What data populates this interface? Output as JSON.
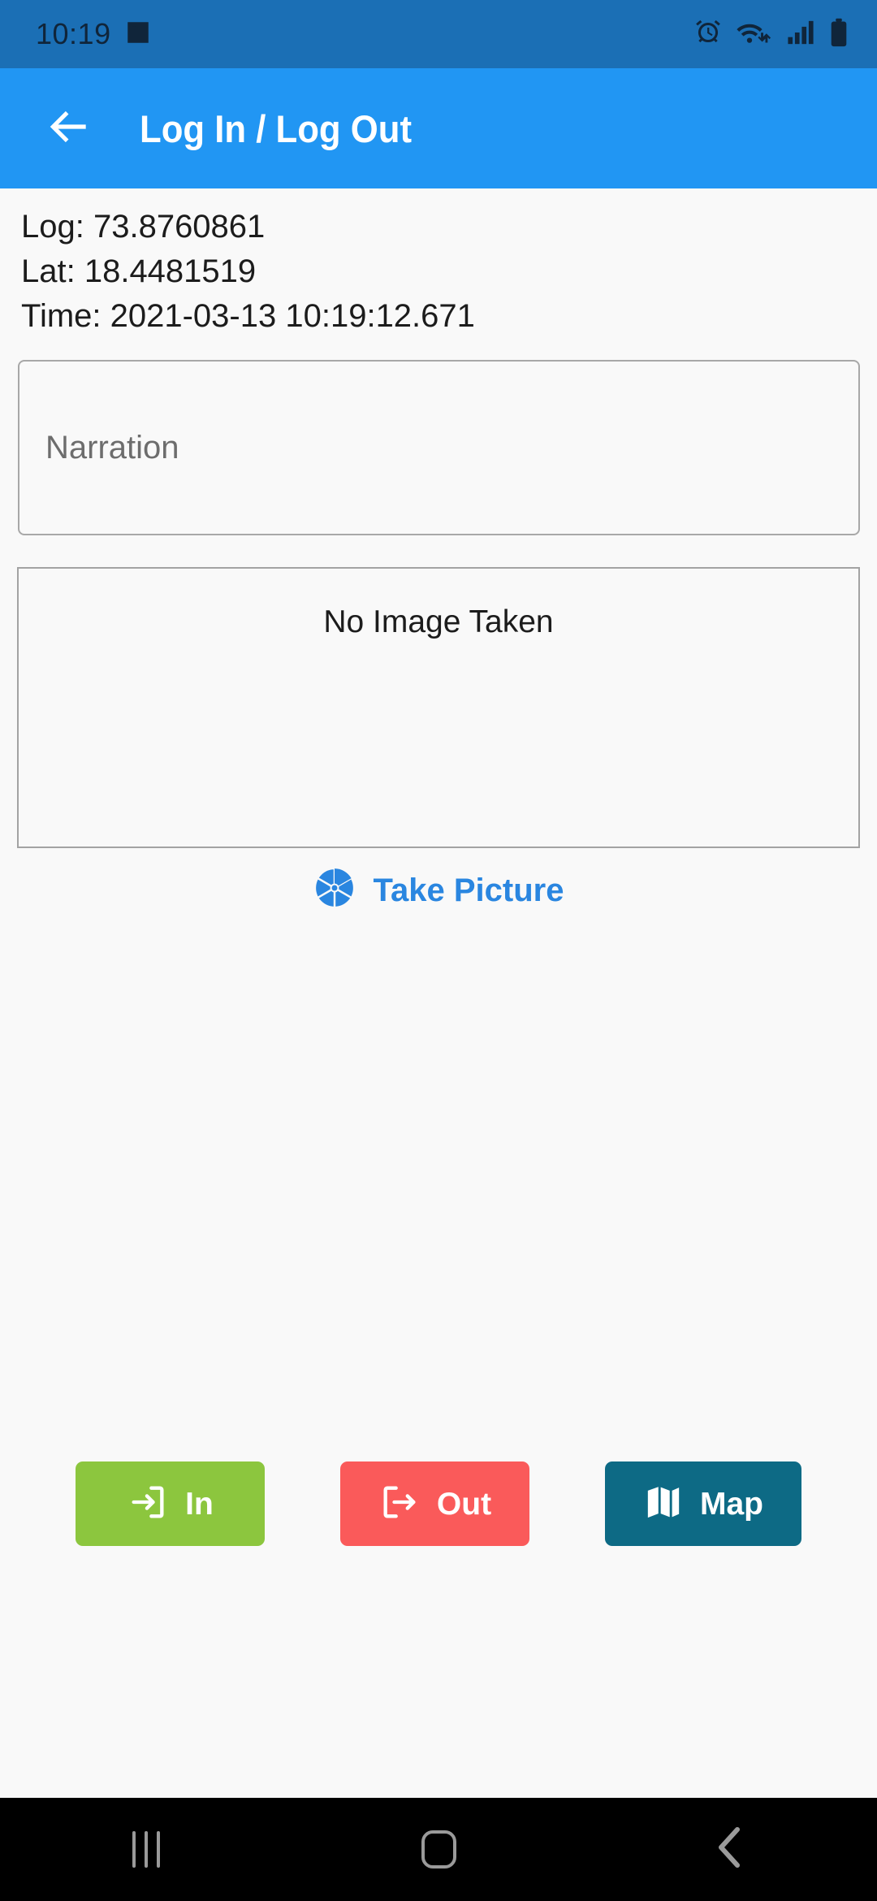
{
  "status_bar": {
    "time": "10:19",
    "left_icons": [
      {
        "name": "image-gallery-icon"
      }
    ],
    "right_icons": [
      {
        "name": "alarm-clock-icon"
      },
      {
        "name": "wifi-icon"
      },
      {
        "name": "cellular-signal-icon"
      },
      {
        "name": "battery-icon"
      }
    ],
    "background_color": "#1B6FB5",
    "icon_color": "#10253A"
  },
  "app_bar": {
    "back_icon": "arrow-left-icon",
    "title": "Log In / Log Out",
    "background_color": "#2196F3",
    "text_color": "#FFFFFF"
  },
  "info": {
    "longitude_line": "Log: 73.8760861",
    "latitude_line": "Lat: 18.4481519",
    "time_line": "Time: 2021-03-13 10:19:12.671",
    "longitude_label": "Log:",
    "longitude_value": "73.8760861",
    "latitude_label": "Lat:",
    "latitude_value": "18.4481519",
    "time_label": "Time:",
    "time_value": "2021-03-13 10:19:12.671"
  },
  "narration": {
    "placeholder": "Narration",
    "value": ""
  },
  "image_preview": {
    "empty_label": "No Image Taken"
  },
  "take_picture": {
    "icon": "camera-aperture-icon",
    "label": "Take Picture",
    "color": "#2A86E0"
  },
  "actions": [
    {
      "name": "in-button",
      "label": "In",
      "icon": "login-icon",
      "color": "#8CC63E"
    },
    {
      "name": "out-button",
      "label": "Out",
      "icon": "logout-icon",
      "color": "#FA5A5A"
    },
    {
      "name": "map-button",
      "label": "Map",
      "icon": "map-icon",
      "color": "#0D6A85"
    }
  ],
  "nav_bar": {
    "recents_label": "Recents",
    "home_label": "Home",
    "back_label": "Back",
    "background_color": "#000000",
    "icon_color": "#9A9A9A"
  }
}
